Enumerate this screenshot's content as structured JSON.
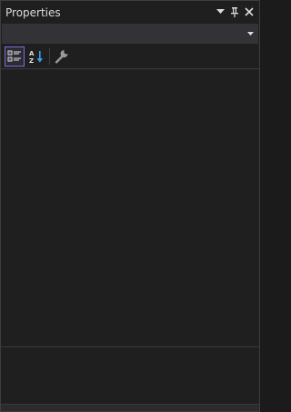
{
  "panel": {
    "title": "Properties"
  },
  "title_buttons": {
    "dropdown_icon": "chevron-down-icon",
    "pin_icon": "pin-icon",
    "close_icon": "close-icon"
  },
  "object_selector": {
    "value": "",
    "arrow_icon": "chevron-down-icon"
  },
  "toolbar": {
    "buttons": [
      {
        "name": "categorized-view",
        "icon": "categorized-list-icon",
        "active": true
      },
      {
        "name": "alphabetical-view",
        "icon": "sort-az-icon",
        "active": false
      },
      {
        "name": "property-pages",
        "icon": "wrench-icon",
        "active": false
      }
    ]
  },
  "colors": {
    "background": "#1f1f1f",
    "combo_background": "#333337",
    "accent": "#7f6bd6",
    "text": "#dcdcdc"
  }
}
